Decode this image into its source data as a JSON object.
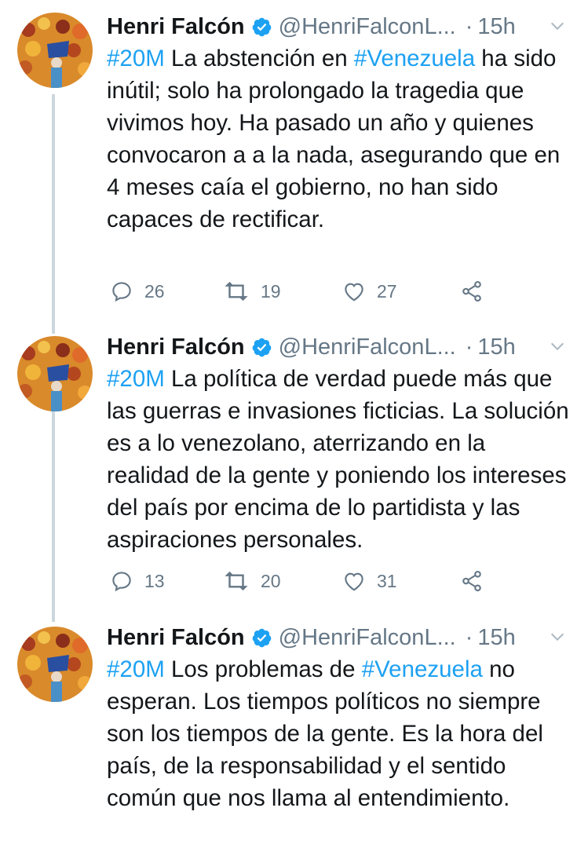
{
  "colors": {
    "link": "#1da1f2",
    "verified": "#1da1f2",
    "muted": "#657786",
    "thread_line": "#ccd6dd"
  },
  "tweets": [
    {
      "name": "Henri Falcón",
      "handle": "@HenriFalconL...",
      "dot": "·",
      "time": "15h",
      "segments": [
        {
          "text": "#20M",
          "link": true
        },
        {
          "text": " La abstención en ",
          "link": false
        },
        {
          "text": "#Venezuela",
          "link": true
        },
        {
          "text": " ha sido inútil; solo ha prolongado la tragedia que vivimos hoy. Ha pasado un año y quienes convocaron a a la nada, asegurando que en 4 meses caía el gobierno, no han sido capaces de rectificar.",
          "link": false
        }
      ],
      "replies": "26",
      "retweets": "19",
      "likes": "27"
    },
    {
      "name": "Henri Falcón",
      "handle": "@HenriFalconL...",
      "dot": "·",
      "time": "15h",
      "segments": [
        {
          "text": "#20M",
          "link": true
        },
        {
          "text": " La política de verdad puede más que las guerras e invasiones ficticias. La solución es a lo venezolano, aterrizando en la realidad de la gente y poniendo los intereses del país por encima de lo partidista y las aspiraciones personales.",
          "link": false
        }
      ],
      "replies": "13",
      "retweets": "20",
      "likes": "31"
    },
    {
      "name": "Henri Falcón",
      "handle": "@HenriFalconL...",
      "dot": "·",
      "time": "15h",
      "segments": [
        {
          "text": "#20M",
          "link": true
        },
        {
          "text": " Los problemas de ",
          "link": false
        },
        {
          "text": "#Venezuela",
          "link": true
        },
        {
          "text": " no esperan. Los tiempos políticos no siempre son los tiempos de la gente. Es la hora del país, de la responsabilidad y el sentido común que nos llama al entendimiento.",
          "link": false
        }
      ]
    }
  ]
}
